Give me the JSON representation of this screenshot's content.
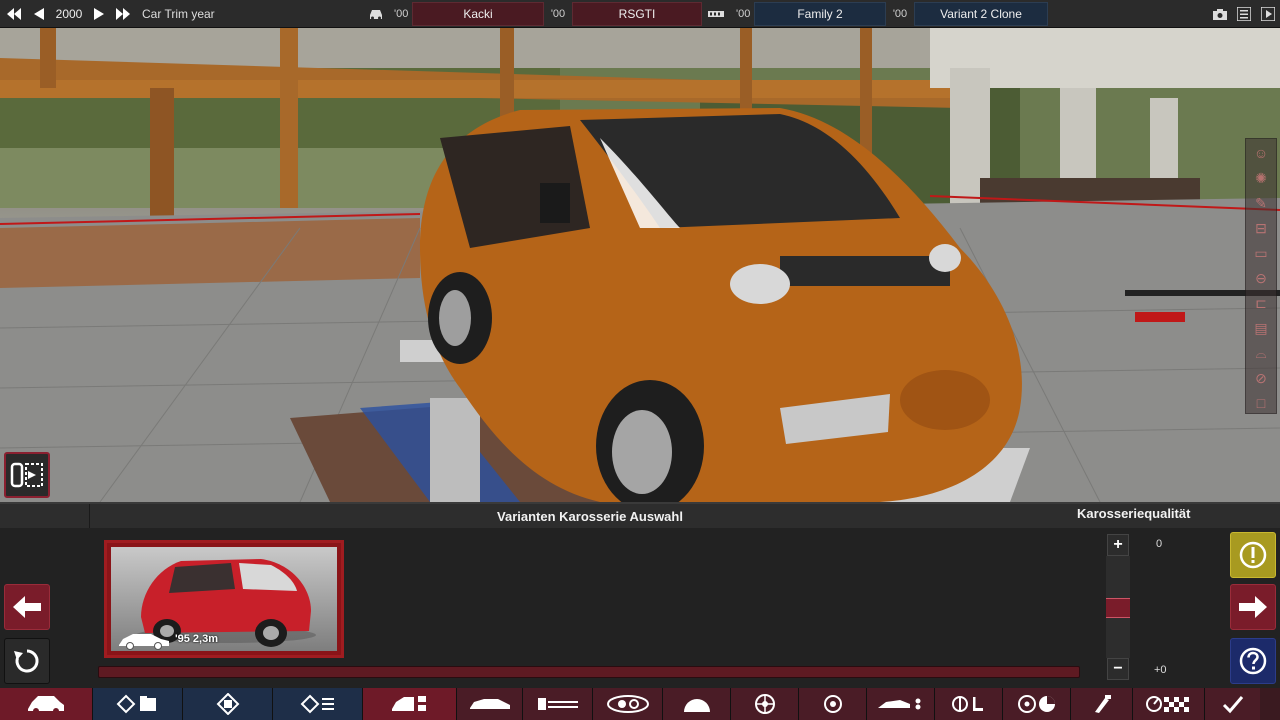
{
  "topbar": {
    "year": "2000",
    "trim_label": "Car Trim year",
    "model_year": "'00",
    "model_name": "Kacki",
    "trim_year": "'00",
    "trim_name": "RSGTI",
    "family_year": "'00",
    "family_name": "Family 2",
    "variant_year": "'00",
    "variant_name": "Variant 2 Clone"
  },
  "panel": {
    "title": "Varianten Karosserie Auswahl",
    "quality_title": "Karosseriequalität",
    "quality_value": "0",
    "quality_delta": "+0",
    "variant": {
      "label": "'95 2,3m",
      "body_color": "#c8202a"
    }
  },
  "colors": {
    "accent_red": "#7a1c2a",
    "accent_blue": "#1e2e48",
    "warning": "#a89a20",
    "help": "#1c2a6a",
    "car_body": "#b56418"
  },
  "icons": {
    "first": "skip-back-icon",
    "prev": "triangle-left-icon",
    "next": "triangle-right-icon",
    "last": "skip-forward-icon",
    "car": "car-icon",
    "engine": "engine-icon",
    "screenshot": "camera-icon",
    "menu": "menu-icon"
  }
}
